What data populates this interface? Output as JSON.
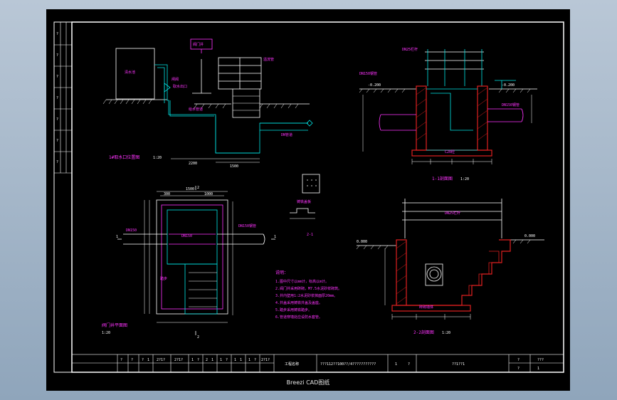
{
  "viewer": {
    "caption": "Breezi CAD图纸",
    "colors": {
      "background": "#000000",
      "frame": "#ffffff",
      "cyan": "#00e5e5",
      "magenta": "#ff33ff",
      "red": "#e02020",
      "yellow": "#e8e800",
      "white": "#ffffff"
    }
  },
  "drawing": {
    "view_tl": {
      "labels": {
        "tank": "清水池",
        "valve": "闸阀",
        "outlet": "取水出口",
        "note1": "给水管道",
        "note2": "溢流管",
        "box": "阀门井",
        "pipe_label": "DN管道"
      },
      "title": "1#取水口位置图",
      "scale": "1:20",
      "dims": [
        "2200",
        "1500"
      ]
    },
    "view_tr": {
      "labels": {
        "rail": "DN25栏杆",
        "pipe1": "DN150钢管",
        "concrete": "C20砼",
        "pipe2": "DN150钢管"
      },
      "elev": [
        "-0.200",
        "-0.200"
      ],
      "title": "1-1剖面图",
      "scale": "1:20"
    },
    "view_bl": {
      "labels": {
        "pipe_l": "DN150",
        "pipe_r": "DN150钢管",
        "inner": "DN150",
        "stair": "踏步"
      },
      "dims_top": [
        "1500",
        "300",
        "1000"
      ],
      "title": "阀门井平面图",
      "scale": "1:20",
      "marks": [
        "2",
        "2",
        "1",
        "1"
      ]
    },
    "view_mid": {
      "title": "2-1",
      "detail": "铸铁盖板"
    },
    "notes": {
      "heading": "说明：",
      "items": [
        "1.图中尺寸以mm计，标高以m计。",
        "2.阀门井采用砖砌，M7.5水泥砂浆砌筑。",
        "3.井内壁用1:2水泥砂浆抹面厚20mm。",
        "4.井盖采用铸铁井盖及盖座。",
        "5.踏步采用铸铁踏步。",
        "6.管道穿墙处应设防水套管。"
      ]
    },
    "view_br": {
      "labels": {
        "rail": "DN25栏杆",
        "elev_l": "0.000",
        "elev_r": "0.000",
        "wall": "砖砌墙体"
      },
      "title": "2-2剖面图",
      "scale": "1:20"
    },
    "title_block": {
      "cells": [
        "?",
        "?",
        "?",
        "1",
        "2?1?",
        "2?1?",
        "1",
        "?",
        "2",
        "1",
        "1",
        "?",
        "1",
        "1",
        "1",
        "?",
        "2?1?"
      ],
      "design": "工程名称",
      "project": "???112??100??/4???????????",
      "sheet_a": "1",
      "sheet_b": "?",
      "drawing_no": "??1??1",
      "right": [
        "?",
        "???",
        "?",
        "1"
      ]
    },
    "left_strip": [
      "?",
      "?",
      "?",
      "?",
      "?",
      "?",
      "?"
    ]
  }
}
